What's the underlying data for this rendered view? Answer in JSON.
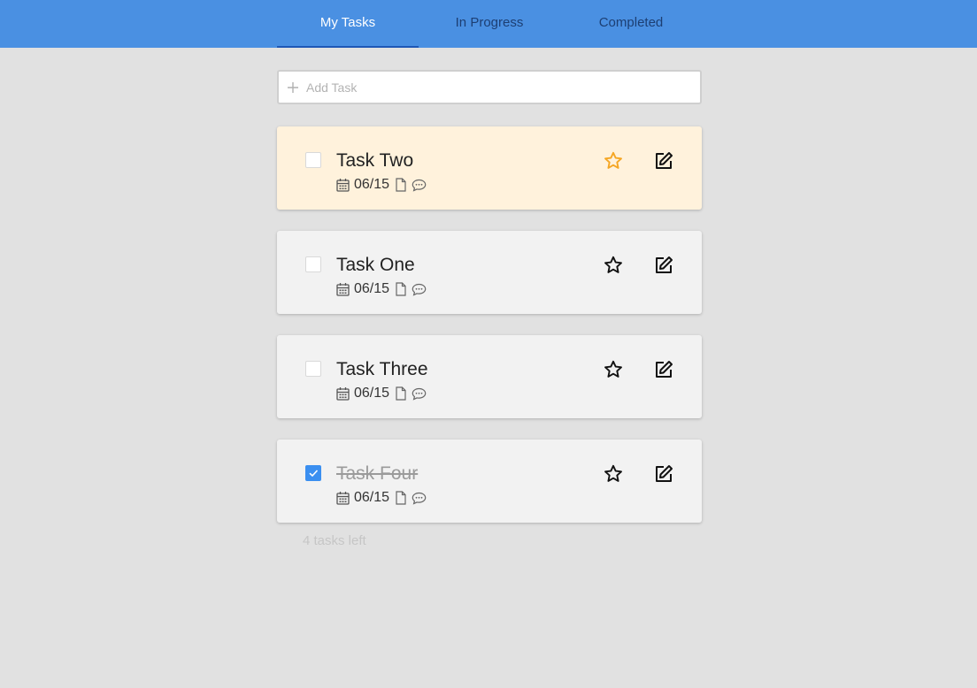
{
  "header": {
    "tabs": [
      {
        "label": "My Tasks",
        "active": true
      },
      {
        "label": "In Progress",
        "active": false
      },
      {
        "label": "Completed",
        "active": false
      }
    ]
  },
  "add_task": {
    "placeholder": "Add Task",
    "icon": "plus-icon"
  },
  "tasks": [
    {
      "title": "Task Two",
      "date": "06/15",
      "important": true,
      "completed": false
    },
    {
      "title": "Task One",
      "date": "06/15",
      "important": false,
      "completed": false
    },
    {
      "title": "Task Three",
      "date": "06/15",
      "important": false,
      "completed": false
    },
    {
      "title": "Task Four",
      "date": "06/15",
      "important": false,
      "completed": true
    }
  ],
  "footer": {
    "tasks_left": "4 tasks left"
  },
  "colors": {
    "header_bg": "#4a90e2",
    "active_tab_text": "#ffffff",
    "inactive_tab_text": "#1d3f73",
    "important_card_bg": "#fff2dc",
    "card_bg": "#f2f2f2",
    "star_important": "#f5a623",
    "checkbox_checked": "#3b8ff0"
  }
}
